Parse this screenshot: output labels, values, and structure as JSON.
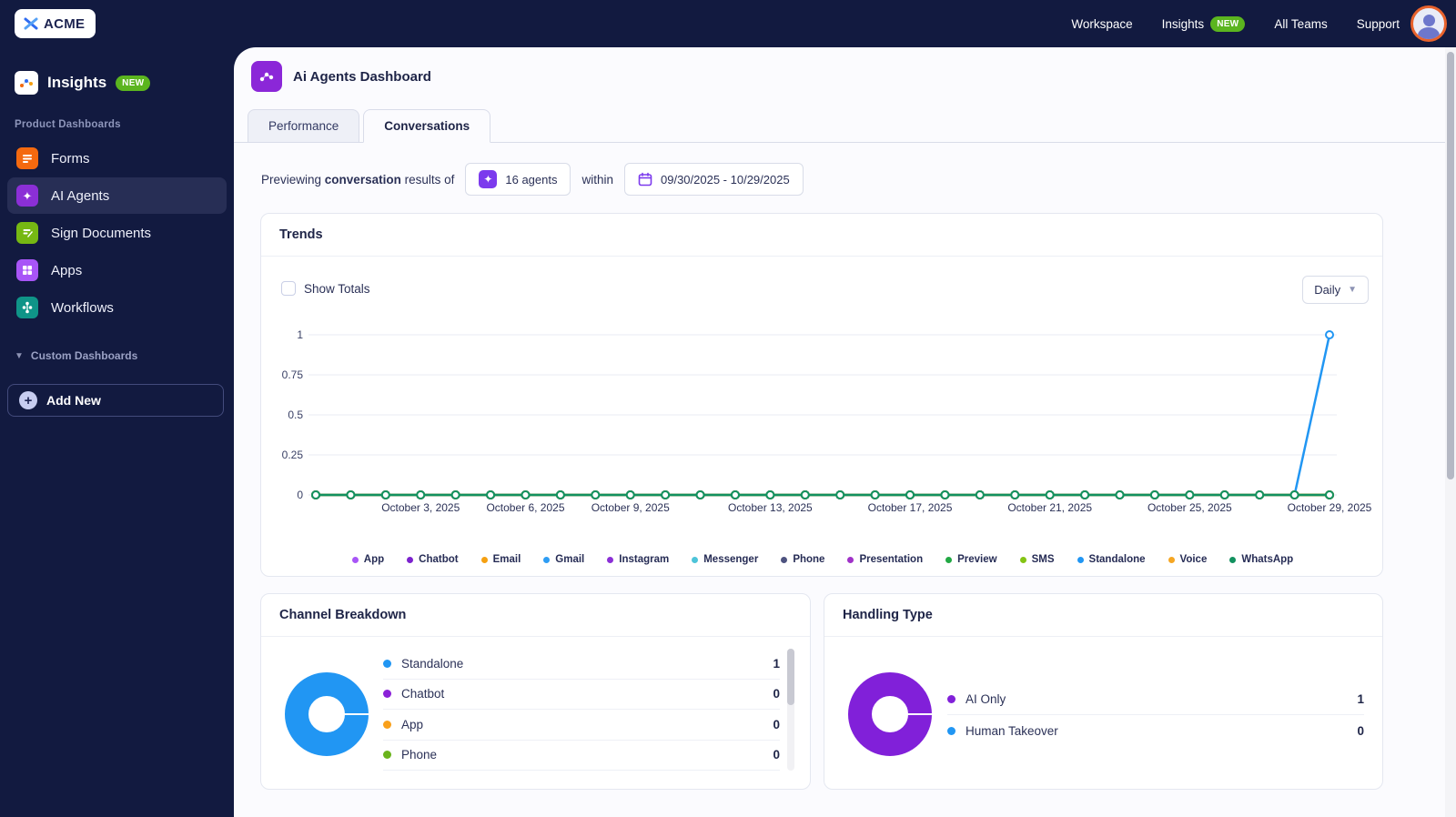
{
  "topbar": {
    "logo_text": "ACME",
    "nav": [
      {
        "label": "Workspace"
      },
      {
        "label": "Insights",
        "badge": "NEW"
      },
      {
        "label": "All Teams"
      },
      {
        "label": "Support"
      }
    ]
  },
  "sidebar": {
    "title": "Insights",
    "title_badge": "NEW",
    "section_label": "Product Dashboards",
    "items": [
      {
        "label": "Forms",
        "color": "#f4690f"
      },
      {
        "label": "AI Agents",
        "color": "#8b2fd6",
        "active": true
      },
      {
        "label": "Sign Documents",
        "color": "#76b813"
      },
      {
        "label": "Apps",
        "color": "#a855f7"
      },
      {
        "label": "Workflows",
        "color": "#0f9488"
      }
    ],
    "custom_section_label": "Custom Dashboards",
    "add_new_label": "Add New"
  },
  "header": {
    "title": "Ai Agents Dashboard"
  },
  "tabs": [
    {
      "label": "Performance",
      "active": false
    },
    {
      "label": "Conversations",
      "active": true
    }
  ],
  "filter_bar": {
    "text_before_bold": "Previewing",
    "text_bold": "conversation",
    "text_after_bold": "results of",
    "agents_button_label": "16 agents",
    "within_label": "within",
    "date_range_label": "09/30/2025 - 10/29/2025"
  },
  "trends_card": {
    "title": "Trends",
    "show_totals_label": "Show Totals",
    "granularity": "Daily"
  },
  "chart_data": {
    "type": "line",
    "title": "Trends",
    "granularity": "Daily",
    "date_range": "09/30/2025 - 10/29/2025",
    "ylim": [
      0,
      1
    ],
    "y_ticks": [
      "0",
      "0.25",
      "0.5",
      "0.75",
      "1"
    ],
    "num_points": 30,
    "x_tick_labels": [
      "October 3, 2025",
      "October 6, 2025",
      "October 9, 2025",
      "October 13, 2025",
      "October 17, 2025",
      "October 21, 2025",
      "October 25, 2025",
      "October 29, 2025"
    ],
    "x_tick_indices": [
      3,
      6,
      9,
      13,
      17,
      21,
      25,
      29
    ],
    "grid": true,
    "legend_position": "bottom",
    "series": [
      {
        "name": "App",
        "color": "#a855f7",
        "values": [
          0,
          0,
          0,
          0,
          0,
          0,
          0,
          0,
          0,
          0,
          0,
          0,
          0,
          0,
          0,
          0,
          0,
          0,
          0,
          0,
          0,
          0,
          0,
          0,
          0,
          0,
          0,
          0,
          0,
          0
        ]
      },
      {
        "name": "Chatbot",
        "color": "#7c22ce",
        "values": [
          0,
          0,
          0,
          0,
          0,
          0,
          0,
          0,
          0,
          0,
          0,
          0,
          0,
          0,
          0,
          0,
          0,
          0,
          0,
          0,
          0,
          0,
          0,
          0,
          0,
          0,
          0,
          0,
          0,
          0
        ]
      },
      {
        "name": "Email",
        "color": "#f5a012",
        "values": [
          0,
          0,
          0,
          0,
          0,
          0,
          0,
          0,
          0,
          0,
          0,
          0,
          0,
          0,
          0,
          0,
          0,
          0,
          0,
          0,
          0,
          0,
          0,
          0,
          0,
          0,
          0,
          0,
          0,
          0
        ]
      },
      {
        "name": "Gmail",
        "color": "#2e9df4",
        "values": [
          0,
          0,
          0,
          0,
          0,
          0,
          0,
          0,
          0,
          0,
          0,
          0,
          0,
          0,
          0,
          0,
          0,
          0,
          0,
          0,
          0,
          0,
          0,
          0,
          0,
          0,
          0,
          0,
          0,
          0
        ]
      },
      {
        "name": "Instagram",
        "color": "#8b2fd6",
        "values": [
          0,
          0,
          0,
          0,
          0,
          0,
          0,
          0,
          0,
          0,
          0,
          0,
          0,
          0,
          0,
          0,
          0,
          0,
          0,
          0,
          0,
          0,
          0,
          0,
          0,
          0,
          0,
          0,
          0,
          0
        ]
      },
      {
        "name": "Messenger",
        "color": "#4dc4d9",
        "values": [
          0,
          0,
          0,
          0,
          0,
          0,
          0,
          0,
          0,
          0,
          0,
          0,
          0,
          0,
          0,
          0,
          0,
          0,
          0,
          0,
          0,
          0,
          0,
          0,
          0,
          0,
          0,
          0,
          0,
          0
        ]
      },
      {
        "name": "Phone",
        "color": "#4e5380",
        "values": [
          0,
          0,
          0,
          0,
          0,
          0,
          0,
          0,
          0,
          0,
          0,
          0,
          0,
          0,
          0,
          0,
          0,
          0,
          0,
          0,
          0,
          0,
          0,
          0,
          0,
          0,
          0,
          0,
          0,
          0
        ]
      },
      {
        "name": "Presentation",
        "color": "#a032c8",
        "values": [
          0,
          0,
          0,
          0,
          0,
          0,
          0,
          0,
          0,
          0,
          0,
          0,
          0,
          0,
          0,
          0,
          0,
          0,
          0,
          0,
          0,
          0,
          0,
          0,
          0,
          0,
          0,
          0,
          0,
          0
        ]
      },
      {
        "name": "Preview",
        "color": "#22a844",
        "values": [
          0,
          0,
          0,
          0,
          0,
          0,
          0,
          0,
          0,
          0,
          0,
          0,
          0,
          0,
          0,
          0,
          0,
          0,
          0,
          0,
          0,
          0,
          0,
          0,
          0,
          0,
          0,
          0,
          0,
          0
        ]
      },
      {
        "name": "SMS",
        "color": "#84c414",
        "values": [
          0,
          0,
          0,
          0,
          0,
          0,
          0,
          0,
          0,
          0,
          0,
          0,
          0,
          0,
          0,
          0,
          0,
          0,
          0,
          0,
          0,
          0,
          0,
          0,
          0,
          0,
          0,
          0,
          0,
          0
        ]
      },
      {
        "name": "Standalone",
        "color": "#2196f3",
        "values": [
          0,
          0,
          0,
          0,
          0,
          0,
          0,
          0,
          0,
          0,
          0,
          0,
          0,
          0,
          0,
          0,
          0,
          0,
          0,
          0,
          0,
          0,
          0,
          0,
          0,
          0,
          0,
          0,
          0,
          1
        ]
      },
      {
        "name": "Voice",
        "color": "#f5a623",
        "values": [
          0,
          0,
          0,
          0,
          0,
          0,
          0,
          0,
          0,
          0,
          0,
          0,
          0,
          0,
          0,
          0,
          0,
          0,
          0,
          0,
          0,
          0,
          0,
          0,
          0,
          0,
          0,
          0,
          0,
          0
        ]
      },
      {
        "name": "WhatsApp",
        "color": "#12915f",
        "values": [
          0,
          0,
          0,
          0,
          0,
          0,
          0,
          0,
          0,
          0,
          0,
          0,
          0,
          0,
          0,
          0,
          0,
          0,
          0,
          0,
          0,
          0,
          0,
          0,
          0,
          0,
          0,
          0,
          0,
          0
        ]
      }
    ]
  },
  "channel_breakdown": {
    "title": "Channel Breakdown",
    "donut_color": "#2196f3",
    "chart_data": {
      "type": "pie",
      "categories": [
        "Standalone",
        "Chatbot",
        "App",
        "Phone"
      ],
      "values": [
        1,
        0,
        0,
        0
      ]
    },
    "rows": [
      {
        "label": "Standalone",
        "value": 1,
        "color": "#2196f3"
      },
      {
        "label": "Chatbot",
        "value": 0,
        "color": "#8b21d8"
      },
      {
        "label": "App",
        "value": 0,
        "color": "#f9a01b"
      },
      {
        "label": "Phone",
        "value": 0,
        "color": "#6ab41c"
      }
    ]
  },
  "handling_type": {
    "title": "Handling Type",
    "donut_color": "#8120d9",
    "chart_data": {
      "type": "pie",
      "categories": [
        "AI Only",
        "Human Takeover"
      ],
      "values": [
        1,
        0
      ]
    },
    "rows": [
      {
        "label": "AI Only",
        "value": 1,
        "color": "#8120d9"
      },
      {
        "label": "Human Takeover",
        "value": 0,
        "color": "#2196f3"
      }
    ]
  },
  "colors": {
    "topbar_bg": "#121a40",
    "accent_purple": "#8b27d8",
    "standalone_blue": "#2196f3",
    "trend_line_green": "#12915f",
    "badge_green": "#5bb51f",
    "avatar_ring_orange": "#e8622c"
  }
}
